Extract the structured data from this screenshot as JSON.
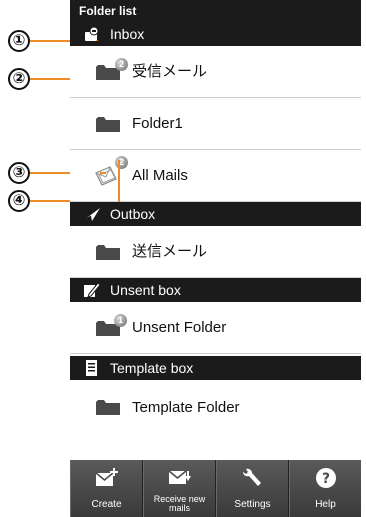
{
  "status_bar": {
    "title": "Folder list"
  },
  "callouts": [
    "①",
    "②",
    "③",
    "④"
  ],
  "inbox": {
    "header": "Inbox",
    "folders": [
      {
        "label": "受信メール",
        "badge": "2"
      },
      {
        "label": "Folder1"
      },
      {
        "label": "All Mails",
        "badge": "2"
      }
    ]
  },
  "outbox": {
    "header": "Outbox",
    "folders": [
      {
        "label": "送信メール"
      }
    ]
  },
  "unsent": {
    "header": "Unsent box",
    "folders": [
      {
        "label": "Unsent Folder",
        "badge": "1"
      }
    ]
  },
  "template": {
    "header": "Template box",
    "folders": [
      {
        "label": "Template Folder"
      }
    ]
  },
  "toolbar": {
    "create": "Create",
    "receive": "Receive new mails",
    "settings": "Settings",
    "help": "Help"
  },
  "colors": {
    "header_bg": "#1b1b1b",
    "leader_line": "#f08a24",
    "toolbar_bg": "#4a4a4a",
    "folder_icon": "#4a4a4a",
    "badge": "#9a9a9a"
  },
  "icons": {
    "inbox": "inbox-icon",
    "outbox": "paper-plane-icon",
    "unsent": "edit-pencil-icon",
    "template": "template-document-icon",
    "create": "new-mail-icon",
    "receive": "receive-mail-icon",
    "settings": "wrench-icon",
    "help": "question-mark-icon"
  }
}
